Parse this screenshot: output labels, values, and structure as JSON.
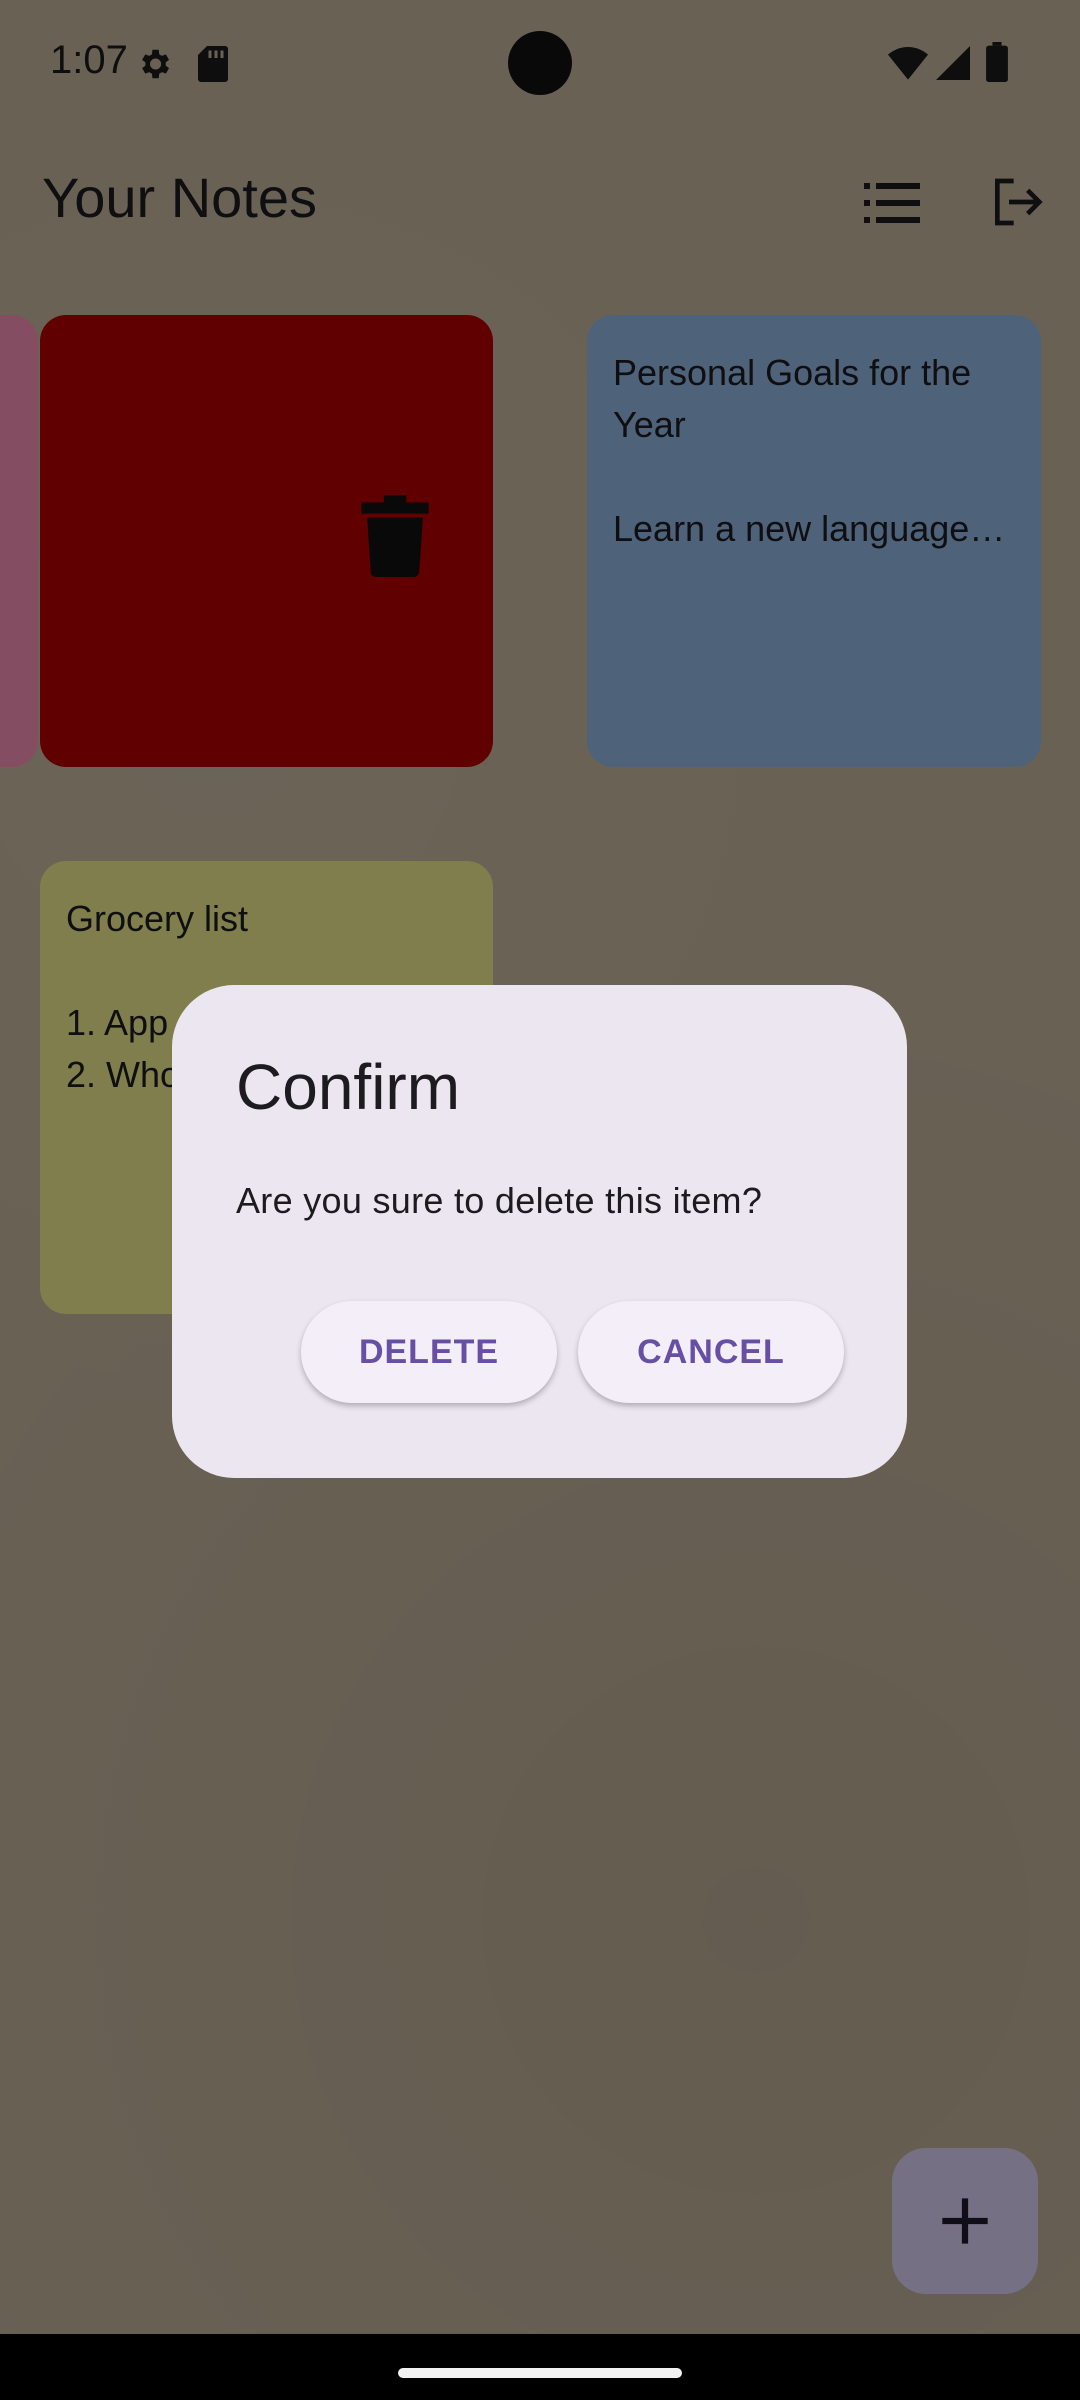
{
  "status_bar": {
    "time": "1:07"
  },
  "app_bar": {
    "title": "Your Notes"
  },
  "notes": {
    "blue": {
      "title": "Personal Goals for the Year",
      "body": "Learn a new language…"
    },
    "yellow": {
      "title": "Grocery list",
      "body_lines": [
        "1. App",
        "2. Who"
      ]
    }
  },
  "dialog": {
    "title": "Confirm",
    "message": "Are you sure to delete this item?",
    "delete_label": "DELETE",
    "cancel_label": "CANCEL"
  },
  "colors": {
    "background": "#bfb199",
    "note_pink": "#f28db2",
    "note_red": "#b00000",
    "note_blue": "#8fb2dd",
    "note_yellow": "#e8e68a",
    "dialog_bg": "#ece6f0",
    "accent": "#6750a4",
    "fab": "#d8ccf0"
  },
  "icons": [
    "gear-icon",
    "sd-card-icon",
    "wifi-icon",
    "signal-icon",
    "battery-icon",
    "list-view-icon",
    "logout-icon",
    "trash-icon",
    "plus-icon"
  ]
}
